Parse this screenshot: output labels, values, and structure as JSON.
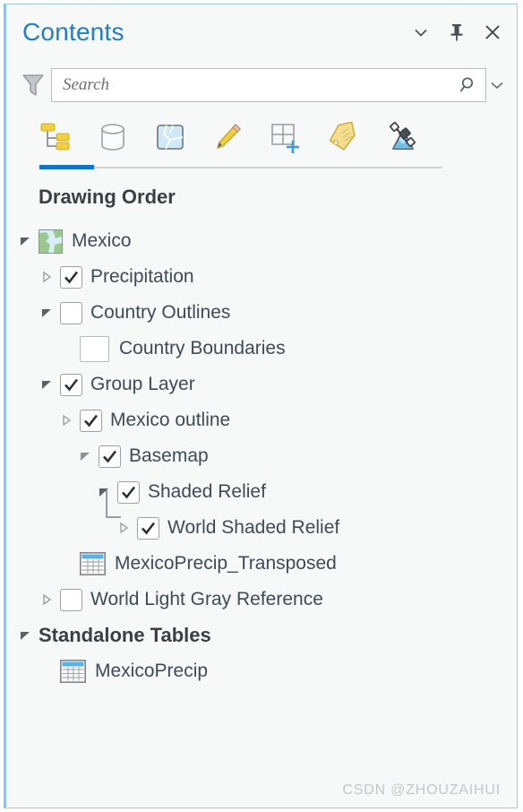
{
  "header": {
    "title": "Contents",
    "buttons": [
      {
        "name": "menu-chevron-icon",
        "label": "Menu"
      },
      {
        "name": "pin-icon",
        "label": "Auto Hide"
      },
      {
        "name": "close-icon",
        "label": "Close"
      }
    ]
  },
  "search": {
    "placeholder": "Search",
    "value": "",
    "filter_icon": "filter-funnel-icon",
    "search_icon": "search-magnifier-icon",
    "caret_icon": "chevron-down-icon"
  },
  "toolbar": {
    "tools": [
      {
        "name": "list-by-drawing-order-icon",
        "label": "List By Drawing Order",
        "active": true
      },
      {
        "name": "list-by-data-source-icon",
        "label": "List By Data Source",
        "active": false
      },
      {
        "name": "list-by-selection-icon",
        "label": "List By Selection",
        "active": false
      },
      {
        "name": "list-by-editing-icon",
        "label": "List By Editing",
        "active": false
      },
      {
        "name": "list-by-snapping-icon",
        "label": "List By Snapping",
        "active": false
      },
      {
        "name": "list-by-labeling-icon",
        "label": "List By Labeling",
        "active": false
      },
      {
        "name": "list-by-diagram-icon",
        "label": "List By Diagramming",
        "active": false
      }
    ]
  },
  "tree": {
    "drawing_order_heading": "Drawing Order",
    "standalone_tables_heading": "Standalone Tables",
    "items": [
      {
        "label": "Mexico",
        "indent": 0,
        "twisty": "expanded",
        "icon": "map-thumbnail",
        "checkbox": "none"
      },
      {
        "label": "Precipitation",
        "indent": 1,
        "twisty": "collapsed",
        "icon": "none",
        "checkbox": "checked"
      },
      {
        "label": "Country Outlines",
        "indent": 1,
        "twisty": "expanded",
        "icon": "none",
        "checkbox": "unchecked"
      },
      {
        "label": "Country Boundaries",
        "indent": 2,
        "twisty": "none",
        "icon": "symbol-swatch",
        "checkbox": "none"
      },
      {
        "label": "Group Layer",
        "indent": 1,
        "twisty": "expanded",
        "icon": "none",
        "checkbox": "checked"
      },
      {
        "label": "Mexico outline",
        "indent": 2,
        "twisty": "collapsed",
        "icon": "none",
        "checkbox": "checked"
      },
      {
        "label": "Basemap",
        "indent": 2,
        "twisty": "expanded-light",
        "icon": "none",
        "checkbox": "checked"
      },
      {
        "label": "Shaded Relief",
        "indent": 3,
        "twisty": "expanded",
        "icon": "none",
        "checkbox": "checked"
      },
      {
        "label": "World Shaded Relief",
        "indent": 4,
        "twisty": "collapsed",
        "icon": "none",
        "checkbox": "checked",
        "connector": true
      },
      {
        "label": "MexicoPrecip_Transposed",
        "indent": 2,
        "twisty": "none",
        "icon": "table",
        "checkbox": "none"
      },
      {
        "label": "World Light Gray Reference",
        "indent": 1,
        "twisty": "collapsed",
        "icon": "none",
        "checkbox": "unchecked"
      },
      {
        "label": "MexicoPrecip",
        "indent": 1,
        "twisty": "none",
        "icon": "table",
        "checkbox": "none"
      }
    ]
  },
  "watermark": "CSDN @ZHOUZAIHUI",
  "colors": {
    "title": "#1f7ec4",
    "accent": "#1275c4",
    "pane_bg": "#f7f9f9",
    "text": "#3f4a58"
  }
}
